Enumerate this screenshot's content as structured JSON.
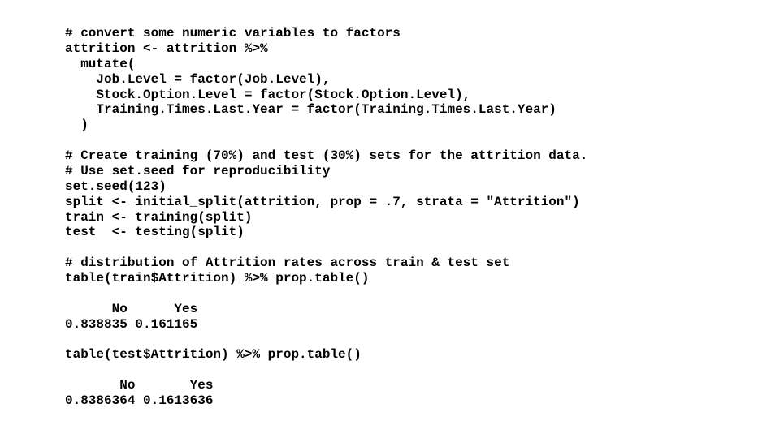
{
  "code": {
    "l01": "# convert some numeric variables to factors",
    "l02": "attrition <- attrition %>%",
    "l03": "  mutate(",
    "l04": "    Job.Level = factor(Job.Level),",
    "l05": "    Stock.Option.Level = factor(Stock.Option.Level),",
    "l06": "    Training.Times.Last.Year = factor(Training.Times.Last.Year)",
    "l07": "  )",
    "l08": "",
    "l09": "# Create training (70%) and test (30%) sets for the attrition data.",
    "l10": "# Use set.seed for reproducibility",
    "l11": "set.seed(123)",
    "l12": "split <- initial_split(attrition, prop = .7, strata = \"Attrition\")",
    "l13": "train <- training(split)",
    "l14": "test  <- testing(split)",
    "l15": "",
    "l16": "# distribution of Attrition rates across train & test set",
    "l17": "table(train$Attrition) %>% prop.table()",
    "l18": "",
    "l19": "      No      Yes",
    "l20": "0.838835 0.161165",
    "l21": "",
    "l22": "table(test$Attrition) %>% prop.table()",
    "l23": "",
    "l24": "       No       Yes",
    "l25": "0.8386364 0.1613636"
  }
}
